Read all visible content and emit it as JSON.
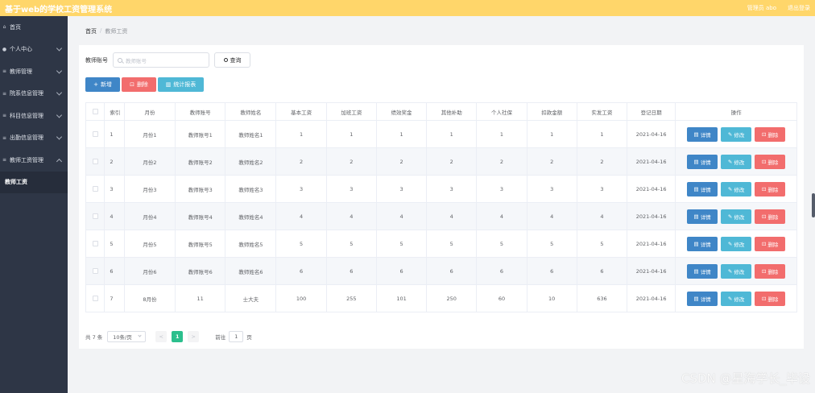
{
  "header": {
    "title": "基于web的学校工资管理系统",
    "user_label": "管理员 abo",
    "logout_label": "退出登录",
    "bg_color": "#ffd66a"
  },
  "sidebar": {
    "items": [
      {
        "label": "首页",
        "icon": "home-icon"
      },
      {
        "label": "个人中心",
        "icon": "user-icon"
      },
      {
        "label": "教师管理",
        "icon": "menu-icon"
      },
      {
        "label": "院系信息管理",
        "icon": "menu-icon"
      },
      {
        "label": "科目信息管理",
        "icon": "menu-icon"
      },
      {
        "label": "出勤信息管理",
        "icon": "menu-icon"
      },
      {
        "label": "教师工资管理",
        "icon": "menu-icon"
      }
    ],
    "active_sub": "教师工资"
  },
  "breadcrumb": {
    "home": "首页",
    "separator": "/",
    "current": "教师工资"
  },
  "search": {
    "label": "教师账号",
    "placeholder": "教师账号",
    "query_label": "查询"
  },
  "actions": {
    "add_label": "新增",
    "delete_label": "删除",
    "stat_label": "统计报表"
  },
  "table": {
    "columns": [
      "索引",
      "月份",
      "教师账号",
      "教师姓名",
      "基本工资",
      "加班工资",
      "绩效奖金",
      "其他补助",
      "个人社保",
      "扣款金额",
      "实发工资",
      "登记日期",
      "操作"
    ],
    "op_labels": {
      "detail": "详情",
      "edit": "修改",
      "delete": "删除"
    },
    "rows": [
      [
        "1",
        "月份1",
        "教师账号1",
        "教师姓名1",
        "1",
        "1",
        "1",
        "1",
        "1",
        "1",
        "1",
        "2021-04-16"
      ],
      [
        "2",
        "月份2",
        "教师账号2",
        "教师姓名2",
        "2",
        "2",
        "2",
        "2",
        "2",
        "2",
        "2",
        "2021-04-16"
      ],
      [
        "3",
        "月份3",
        "教师账号3",
        "教师姓名3",
        "3",
        "3",
        "3",
        "3",
        "3",
        "3",
        "3",
        "2021-04-16"
      ],
      [
        "4",
        "月份4",
        "教师账号4",
        "教师姓名4",
        "4",
        "4",
        "4",
        "4",
        "4",
        "4",
        "4",
        "2021-04-16"
      ],
      [
        "5",
        "月份5",
        "教师账号5",
        "教师姓名5",
        "5",
        "5",
        "5",
        "5",
        "5",
        "5",
        "5",
        "2021-04-16"
      ],
      [
        "6",
        "月份6",
        "教师账号6",
        "教师姓名6",
        "6",
        "6",
        "6",
        "6",
        "6",
        "6",
        "6",
        "2021-04-16"
      ],
      [
        "7",
        "8月份",
        "11",
        "士大夫",
        "100",
        "255",
        "101",
        "250",
        "60",
        "10",
        "636",
        "2021-04-16"
      ]
    ]
  },
  "pagination": {
    "total": "共 7 条",
    "page_size": "10条/页",
    "prev": "<",
    "current_page": "1",
    "next": ">",
    "goto_prefix": "前往",
    "goto_value": "1",
    "goto_suffix": "页"
  },
  "watermark": "CSDN @星海学长_毕设"
}
